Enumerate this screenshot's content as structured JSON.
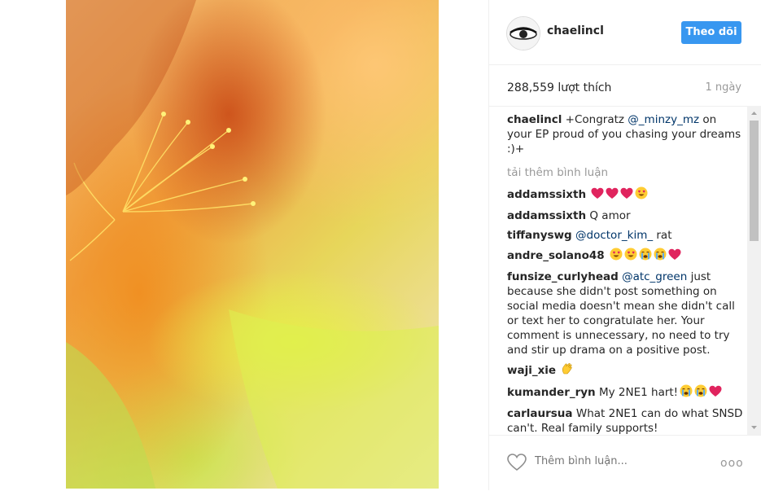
{
  "post": {
    "username": "chaelincl",
    "follow_label": "Theo dõi",
    "likes": "288,559 lượt thích",
    "time": "1 ngày"
  },
  "caption": {
    "user": "chaelincl",
    "pre": "+Congratz ",
    "mention": "@_minzy_mz",
    "post": " on your EP proud of you chasing your dreams :)+"
  },
  "load_more": "tải thêm bình luận",
  "comments": [
    {
      "user": "addamssixth",
      "text": "",
      "emoji": [
        "red-heart",
        "red-heart",
        "red-heart",
        "heart-eyes"
      ]
    },
    {
      "user": "addamssixth",
      "text": "Q amor",
      "emoji": []
    },
    {
      "user": "tiffanyswg",
      "mention": "@doctor_kim_",
      "text": " rat",
      "emoji": []
    },
    {
      "user": "andre_solano48",
      "text": "",
      "emoji": [
        "heart-eyes",
        "heart-eyes",
        "crying-face",
        "crying-face",
        "red-heart"
      ]
    },
    {
      "user": "funsize_curlyhead",
      "mention": "@atc_green",
      "text": " just because she didn't post something on social media doesn't mean she didn't call or text her to congratulate her. Your comment is unnecessary, no need to try and stir up drama on a positive post.",
      "emoji": []
    },
    {
      "user": "waji_xie",
      "text": "",
      "emoji": [
        "clapping-hands"
      ]
    },
    {
      "user": "kumander_ryn",
      "text": "My 2NE1 hart!",
      "emoji": [
        "crying-face",
        "crying-face",
        "red-heart"
      ]
    },
    {
      "user": "carlaursua",
      "text": "What 2NE1 can do what SNSD can't. Real family supports!",
      "emoji": []
    }
  ],
  "add_comment_placeholder": "Thêm bình luận...",
  "more_label": "ooo",
  "colors": {
    "follow": "#3897f0",
    "mention": "#003569",
    "muted": "#999999"
  }
}
